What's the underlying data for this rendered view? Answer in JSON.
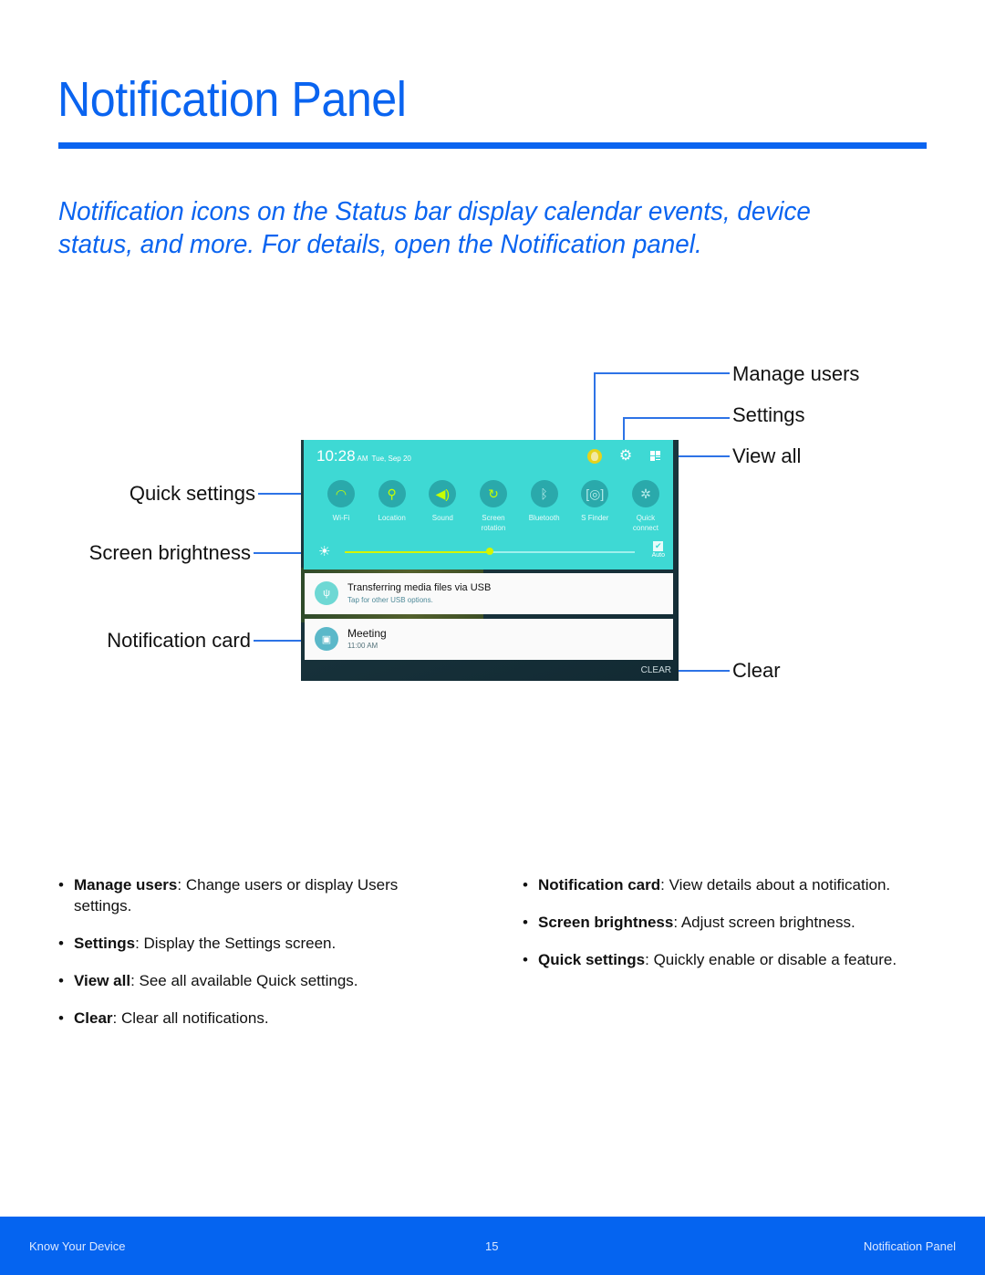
{
  "page": {
    "title": "Notification Panel",
    "intro": "Notification icons on the Status bar display calendar events, device status, and more. For details, open the Notification panel.",
    "accent_color": "#0a64f0"
  },
  "callouts": {
    "manage_users": "Manage users",
    "settings": "Settings",
    "view_all": "View all",
    "quick_settings": "Quick settings",
    "screen_brightness": "Screen brightness",
    "notification_card": "Notification card",
    "clear": "Clear"
  },
  "panel": {
    "time": "10:28",
    "ampm": "AM",
    "date": "Tue, Sep 20",
    "header_icons": [
      "manage-users-icon",
      "settings-gear-icon",
      "view-all-icon"
    ],
    "tiles": [
      {
        "label": "Wi-Fi",
        "icon": "wifi-icon",
        "active": true
      },
      {
        "label": "Location",
        "icon": "location-pin-icon",
        "active": true
      },
      {
        "label": "Sound",
        "icon": "speaker-icon",
        "active": true
      },
      {
        "label": "Screen rotation",
        "icon": "screen-rotation-icon",
        "active": true
      },
      {
        "label": "Bluetooth",
        "icon": "bluetooth-icon",
        "active": false
      },
      {
        "label": "S Finder",
        "icon": "s-finder-icon",
        "active": false
      },
      {
        "label": "Quick connect",
        "icon": "quick-connect-icon",
        "active": false
      }
    ],
    "brightness": {
      "level_percent": 50,
      "auto_label": "Auto",
      "auto_checked": true
    },
    "notifications": [
      {
        "title": "Transferring media files via USB",
        "subtitle": "Tap for other USB options.",
        "icon": "usb-icon"
      },
      {
        "title": "Meeting",
        "subtitle": "11:00 AM",
        "icon": "calendar-icon"
      }
    ],
    "clear_label": "CLEAR",
    "colors": {
      "quick_panel": "#3ed9d4",
      "active_icon": "#c6ff00"
    }
  },
  "bullets_left": [
    {
      "term": "Manage users",
      "desc": ": Change users or display Users settings."
    },
    {
      "term": "Settings",
      "desc": ": Display the Settings screen."
    },
    {
      "term": "View all",
      "desc": ": See all available Quick settings."
    },
    {
      "term": "Clear",
      "desc": ": Clear all notifications."
    }
  ],
  "bullets_right": [
    {
      "term": "Notification card",
      "desc": ": View details about a notification."
    },
    {
      "term": "Screen brightness",
      "desc": ": Adjust screen brightness."
    },
    {
      "term": "Quick settings",
      "desc": ": Quickly enable or disable a feature."
    }
  ],
  "footer": {
    "left": "Know Your Device",
    "page_number": "15",
    "right": "Notification Panel"
  }
}
